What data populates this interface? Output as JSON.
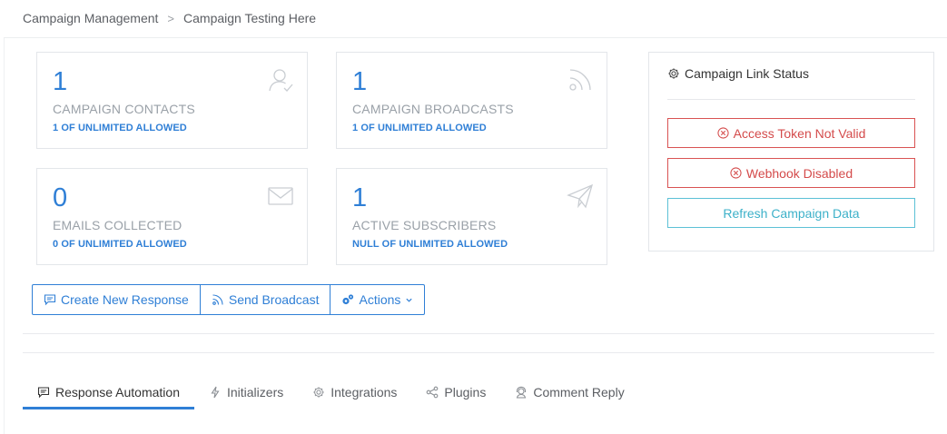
{
  "breadcrumb": {
    "parent": "Campaign Management",
    "separator": ">",
    "current": "Campaign Testing Here"
  },
  "stats": [
    {
      "value": "1",
      "label": "CAMPAIGN CONTACTS",
      "sub": "1 OF UNLIMITED ALLOWED",
      "icon": "user-check-icon"
    },
    {
      "value": "1",
      "label": "CAMPAIGN BROADCASTS",
      "sub": "1 OF UNLIMITED ALLOWED",
      "icon": "rss-icon"
    },
    {
      "value": "0",
      "label": "EMAILS COLLECTED",
      "sub": "0 OF UNLIMITED ALLOWED",
      "icon": "envelope-icon"
    },
    {
      "value": "1",
      "label": "ACTIVE SUBSCRIBERS",
      "sub": "NULL OF UNLIMITED ALLOWED",
      "icon": "paper-plane-icon"
    }
  ],
  "link_status": {
    "title": "Campaign Link Status",
    "token_label": "Access Token Not Valid",
    "webhook_label": "Webhook Disabled",
    "refresh_label": "Refresh Campaign Data"
  },
  "actions": {
    "create_label": "Create New Response",
    "broadcast_label": "Send Broadcast",
    "actions_label": "Actions"
  },
  "tabs": [
    {
      "label": "Response Automation",
      "active": true
    },
    {
      "label": "Initializers",
      "active": false
    },
    {
      "label": "Integrations",
      "active": false
    },
    {
      "label": "Plugins",
      "active": false
    },
    {
      "label": "Comment Reply",
      "active": false
    }
  ],
  "colors": {
    "primary": "#2f7fd6",
    "danger": "#d44b4b",
    "info": "#3db1c9",
    "muted": "#9aa1a8"
  }
}
